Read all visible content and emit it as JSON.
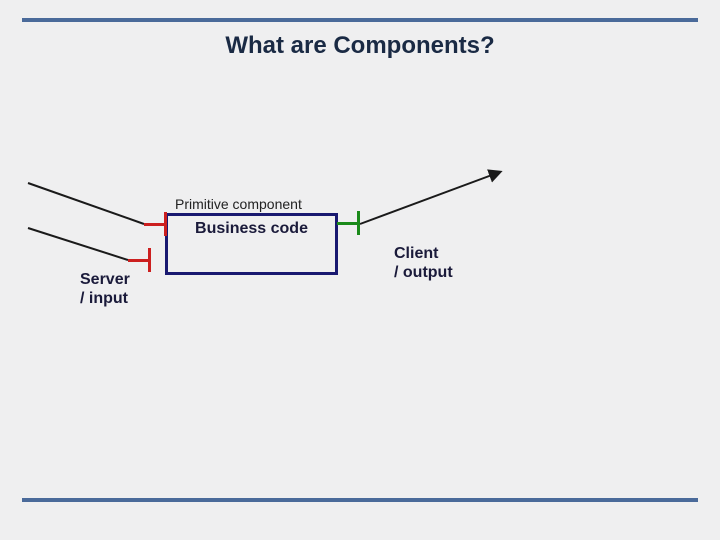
{
  "title": "What are Components?",
  "component": {
    "caption": "Primitive component",
    "inner_label": "Business code"
  },
  "side_labels": {
    "left_line1": "Server",
    "left_line2": "/ input",
    "right_line1": "Client",
    "right_line2": "/ output"
  },
  "ports": {
    "server_upper": "server-port-upper",
    "server_lower": "server-port-lower",
    "client": "client-port"
  },
  "colors": {
    "rule": "#4a6a9a",
    "box_border": "#191970",
    "server_port": "#cc1f1f",
    "client_port": "#1a8a1a",
    "wire": "#1a1a1a"
  }
}
